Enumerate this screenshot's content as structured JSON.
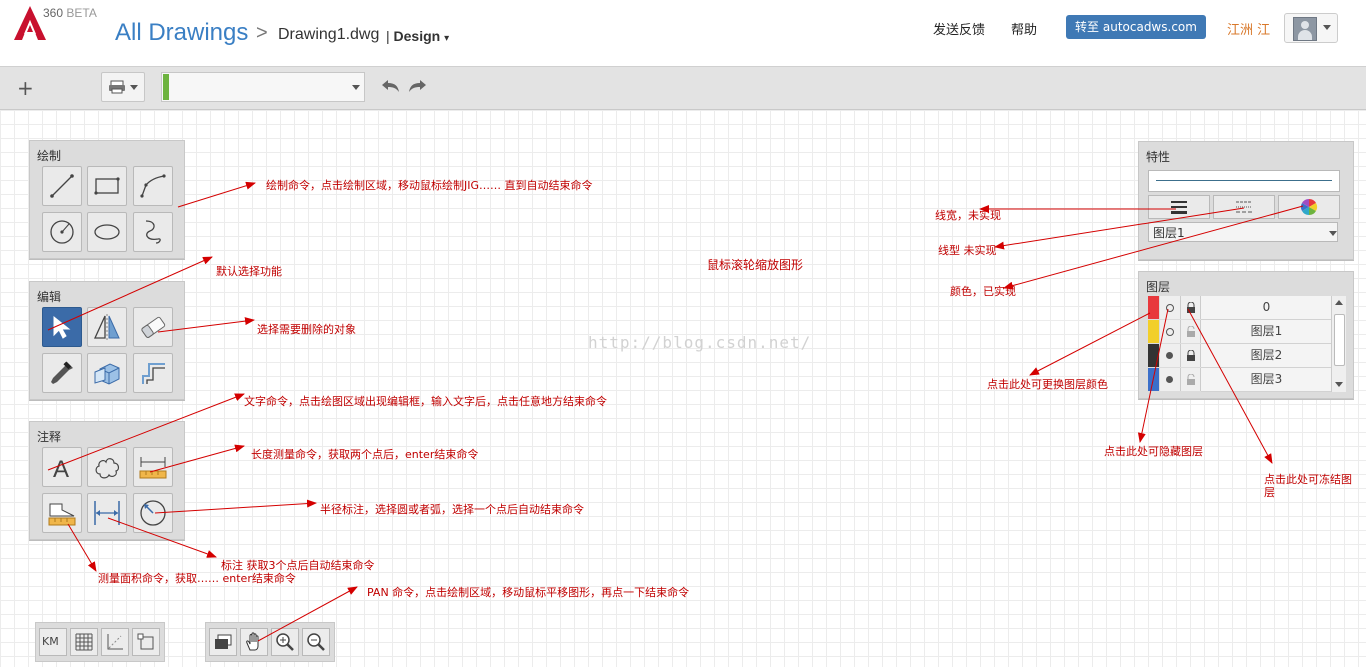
{
  "header": {
    "beta_prefix": "360",
    "beta_suffix": "BETA",
    "breadcrumb_root": "All Drawings",
    "breadcrumb_sep": ">",
    "file_name": "Drawing1.dwg",
    "mode_prefix": "|",
    "mode": "Design",
    "feedback": "发送反馈",
    "help": "帮助",
    "goto_button": "转至 autocadws.com",
    "user_name": "江洲 江"
  },
  "toolbar": {
    "plus": "+"
  },
  "canvas": {
    "watermark": "http://blog.csdn.net/",
    "hint": "鼠标滚轮缩放图形"
  },
  "panels": {
    "draw": {
      "title": "绘制"
    },
    "edit": {
      "title": "编辑"
    },
    "annotate": {
      "title": "注释"
    },
    "properties": {
      "title": "特性",
      "layer_value": "图层1"
    },
    "layers": {
      "title": "图层",
      "rows": [
        {
          "name": "0",
          "color": "#e8383d",
          "visible": "hollow"
        },
        {
          "name": "图层1",
          "color": "#f2cf2a",
          "visible": "hollow"
        },
        {
          "name": "图层2",
          "color": "#333333",
          "visible": "filled"
        },
        {
          "name": "图层3",
          "color": "#3b6fc9",
          "visible": "filled"
        }
      ]
    },
    "bottom_left": {
      "km_label": "KM"
    }
  },
  "annotations": {
    "draw": "绘制命令，点击绘制区域，移动鼠标绘制JIG…… 直到自动结束命令",
    "select": "默认选择功能",
    "erase": "选择需要删除的对象",
    "text": "文字命令，点击绘图区域出现编辑框，输入文字后，点击任意地方结束命令",
    "length": "长度测量命令，获取两个点后，enter结束命令",
    "radius": "半径标注，选择圆或者弧，选择一个点后自动结束命令",
    "dimension": "标注 获取3个点后自动结束命令",
    "area": "测量面积命令，获取…… enter结束命令",
    "pan": "PAN 命令，点击绘制区域，移动鼠标平移图形，再点一下结束命令",
    "lineweight": "线宽，未实现",
    "linetype": "线型 未实现",
    "color": "颜色，已实现",
    "layer_color": "点击此处可更换图层颜色",
    "layer_hide": "点击此处可隐藏图层",
    "layer_freeze_1": "点击此处可冻结图",
    "layer_freeze_2": "层"
  },
  "colors": {
    "link_blue": "#3a7fc4",
    "button_blue": "#3f79b5",
    "user_orange": "#d9782a",
    "annotation_red": "#c00000",
    "selected_tool": "#3b6ba8",
    "layer_swatch_green": "#6db33f"
  }
}
